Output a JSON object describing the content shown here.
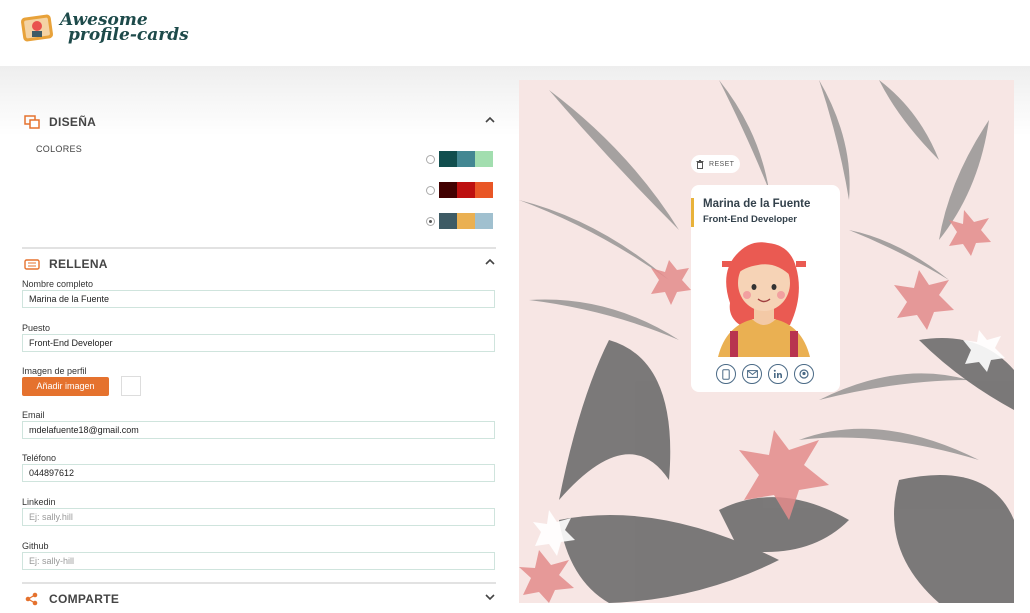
{
  "app": {
    "logo_line1": "Awesome",
    "logo_line2": "profile-cards"
  },
  "design": {
    "title": "DISEÑA",
    "colors_label": "COLORES",
    "palettes": [
      {
        "colors": [
          "#114e4e",
          "#438792",
          "#a2deaf"
        ],
        "selected": false
      },
      {
        "colors": [
          "#420101",
          "#bd1010",
          "#e95626"
        ],
        "selected": false
      },
      {
        "colors": [
          "#3e5b65",
          "#eab052",
          "#a0c0cf"
        ],
        "selected": true
      }
    ]
  },
  "fill": {
    "title": "RELLENA",
    "name_label": "Nombre completo",
    "name_value": "Marina de la Fuente",
    "job_label": "Puesto",
    "job_value": "Front-End Developer",
    "image_label": "Imagen de perfil",
    "upload_button": "Añadir imagen",
    "email_label": "Email",
    "email_value": "mdelafuente18@gmail.com",
    "phone_label": "Teléfono",
    "phone_value": "044897612",
    "linkedin_label": "Linkedin",
    "linkedin_placeholder": "Ej: sally.hill",
    "github_label": "Github",
    "github_placeholder": "Ej: sally-hill"
  },
  "share": {
    "title": "COMPARTE"
  },
  "preview": {
    "reset_label": "RESET",
    "card_name": "Marina de la Fuente",
    "card_job": "Front-End Developer",
    "accent": "#e8b23a"
  }
}
